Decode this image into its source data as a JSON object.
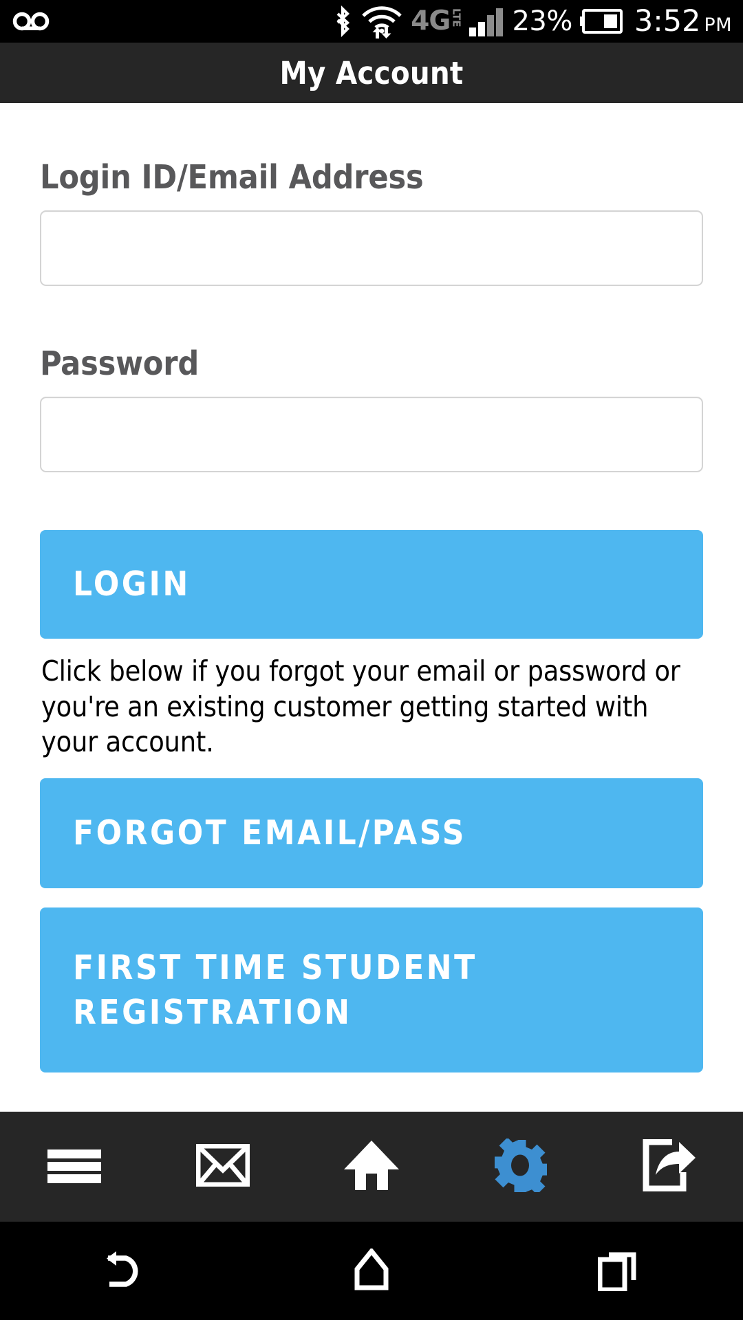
{
  "status_bar": {
    "voicemail_icon": "voicemail-icon",
    "bluetooth_icon": "bluetooth-icon",
    "wifi_icon": "wifi-icon",
    "network_type": "4G",
    "network_suffix": "LTE",
    "signal_icon": "signal-bars-icon",
    "battery_percent": "23%",
    "battery_icon": "battery-icon",
    "time": "3:52",
    "meridiem": "PM"
  },
  "title_bar": {
    "title": "My Account"
  },
  "form": {
    "login_label": "Login ID/Email Address",
    "login_value": "",
    "login_placeholder": "",
    "password_label": "Password",
    "password_value": "",
    "password_placeholder": ""
  },
  "actions": {
    "login_label": "LOGIN",
    "helper_text": "Click below if you forgot your email or password or you're an existing customer getting started with your account.",
    "forgot_label": "FORGOT EMAIL/PASS",
    "register_label": "FIRST TIME STUDENT REGISTRATION"
  },
  "app_toolbar": {
    "items": [
      {
        "name": "menu",
        "icon": "hamburger-menu-icon",
        "active": false
      },
      {
        "name": "mail",
        "icon": "envelope-icon",
        "active": false
      },
      {
        "name": "home",
        "icon": "home-icon",
        "active": false
      },
      {
        "name": "settings",
        "icon": "gear-icon",
        "active": true
      },
      {
        "name": "share",
        "icon": "share-icon",
        "active": false
      }
    ]
  },
  "nav_bar": {
    "items": [
      {
        "name": "back",
        "icon": "back-arrow-icon"
      },
      {
        "name": "home",
        "icon": "home-pentagon-icon"
      },
      {
        "name": "recents",
        "icon": "recent-apps-icon"
      }
    ]
  },
  "colors": {
    "accent_blue": "#4eb7f0",
    "toolbar_active_blue": "#3d8fd1",
    "title_bar_bg": "#262626",
    "status_bar_bg": "#000000",
    "label_gray": "#58585a",
    "input_border": "#d4d4d4"
  }
}
